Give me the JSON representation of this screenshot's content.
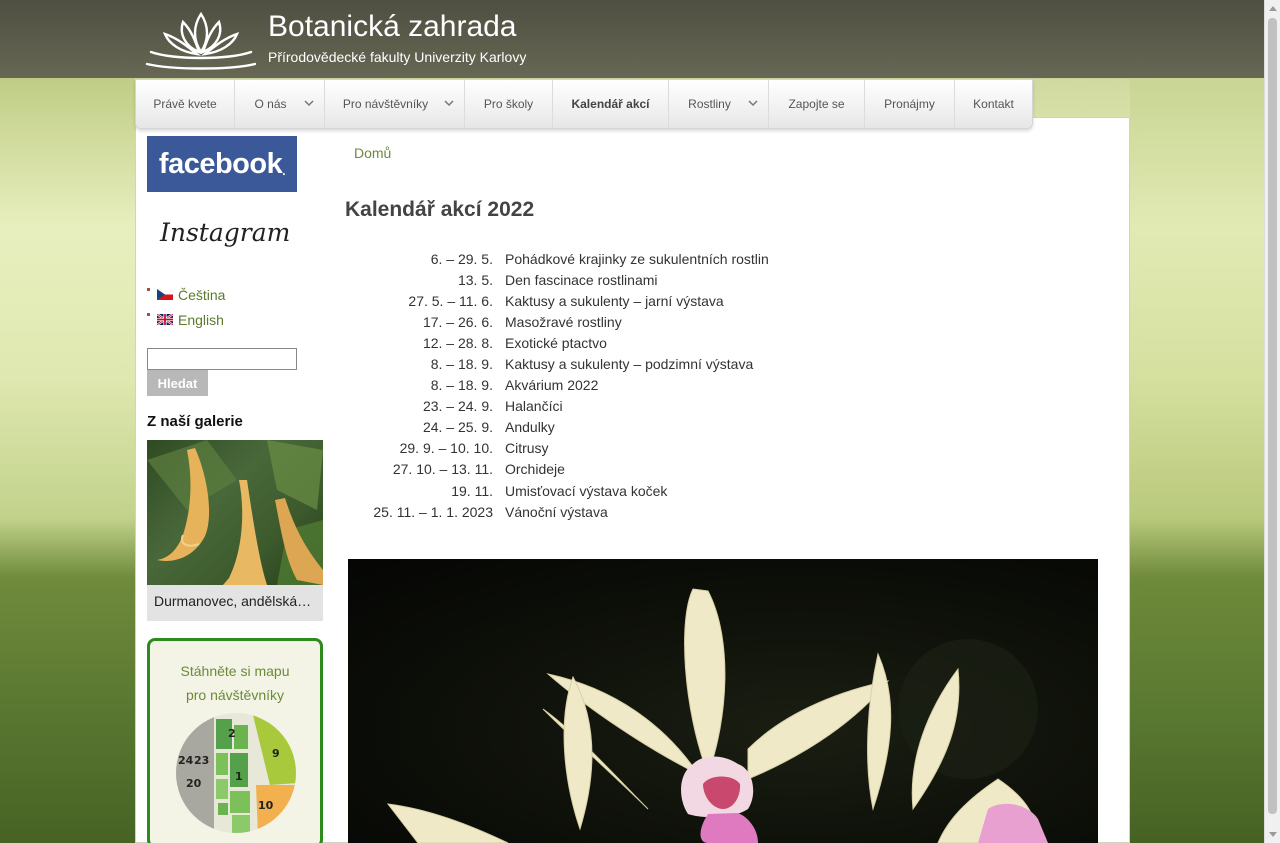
{
  "header": {
    "title": "Botanická zahrada",
    "subtitle": "Přírodovědecké fakulty Univerzity Karlovy"
  },
  "nav": {
    "items": [
      {
        "label": "Právě kvete",
        "dropdown": false,
        "active": false
      },
      {
        "label": "O nás",
        "dropdown": true,
        "active": false
      },
      {
        "label": "Pro návštěvníky",
        "dropdown": true,
        "active": false
      },
      {
        "label": "Pro školy",
        "dropdown": false,
        "active": false
      },
      {
        "label": "Kalendář akcí",
        "dropdown": false,
        "active": true
      },
      {
        "label": "Rostliny",
        "dropdown": true,
        "active": false
      },
      {
        "label": "Zapojte se",
        "dropdown": false,
        "active": false
      },
      {
        "label": "Pronájmy",
        "dropdown": false,
        "active": false
      },
      {
        "label": "Kontakt",
        "dropdown": false,
        "active": false
      }
    ]
  },
  "sidebar": {
    "facebook_label": "facebook",
    "instagram_label": "Instagram",
    "languages": [
      {
        "label": "Čeština",
        "flag": "cz-flag-icon"
      },
      {
        "label": "English",
        "flag": "uk-flag-icon"
      }
    ],
    "search": {
      "value": "",
      "button_label": "Hledat"
    },
    "gallery": {
      "title": "Z naší galerie",
      "caption": "Durmanovec, andělská…"
    },
    "map": {
      "line1": "Stáhněte si mapu",
      "line2": "pro návštěvníky",
      "sections": [
        "2",
        "9",
        "24",
        "23",
        "20",
        "1",
        "10"
      ]
    }
  },
  "main": {
    "breadcrumb": "Domů",
    "title": "Kalendář akcí 2022",
    "events": [
      {
        "date": "6. – 29. 5.",
        "name": "Pohádkové krajinky ze sukulentních rostlin"
      },
      {
        "date": "13. 5.",
        "name": "Den fascinace rostlinami"
      },
      {
        "date": "27. 5. – 11. 6.",
        "name": "Kaktusy a sukulenty – jarní výstava"
      },
      {
        "date": "17. – 26. 6.",
        "name": "Masožravé rostliny"
      },
      {
        "date": "12. – 28. 8.",
        "name": "Exotické ptactvo"
      },
      {
        "date": "8. – 18. 9.",
        "name": "Kaktusy a sukulenty – podzimní výstava"
      },
      {
        "date": "8. – 18. 9.",
        "name": "Akvárium 2022"
      },
      {
        "date": "23. – 24. 9.",
        "name": "Halančíci"
      },
      {
        "date": "24. – 25. 9.",
        "name": "Andulky"
      },
      {
        "date": "29. 9. – 10. 10.",
        "name": "Citrusy"
      },
      {
        "date": "27. 10. – 13. 11.",
        "name": "Orchideje"
      },
      {
        "date": "19. 11.",
        "name": "Umisťovací výstava koček"
      },
      {
        "date": "25. 11. – 1. 1. 2023",
        "name": "Vánoční výstava"
      }
    ]
  },
  "colors": {
    "header_bg": "#5b5b4a",
    "link_green": "#6c8a3a",
    "facebook_blue": "#3b5998",
    "map_border": "#2f8a1e"
  }
}
